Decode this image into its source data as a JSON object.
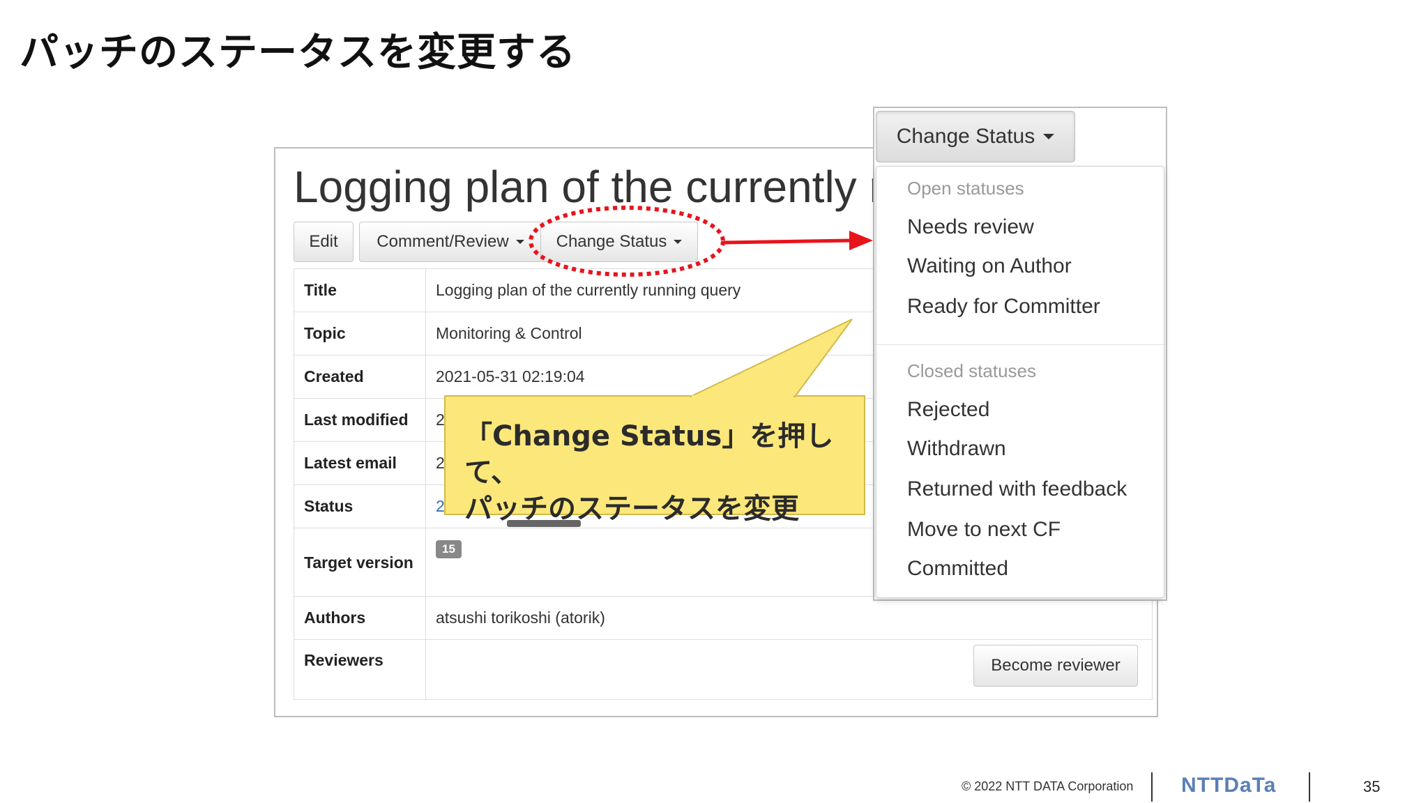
{
  "slide": {
    "title": "パッチのステータスを変更する",
    "callout_line1": "「Change Status」を押して、",
    "callout_line2": "パッチのステータスを変更"
  },
  "patch": {
    "heading": "Logging plan of the currently r",
    "buttons": {
      "edit": "Edit",
      "comment_review": "Comment/Review",
      "change_status": "Change Status"
    },
    "fields": {
      "title_label": "Title",
      "title_value": "Logging plan of the currently running query",
      "topic_label": "Topic",
      "topic_value": "Monitoring & Control",
      "created_label": "Created",
      "created_value": "2021-05-31 02:19:04",
      "last_modified_label": "Last modified",
      "last_modified_value": "2",
      "latest_email_label": "Latest email",
      "latest_email_value": "2",
      "status_label": "Status",
      "status_value": "2",
      "target_version_label": "Target version",
      "target_version_value": "15",
      "authors_label": "Authors",
      "authors_value": "atsushi torikoshi (atorik)",
      "reviewers_label": "Reviewers"
    },
    "become_reviewer": "Become reviewer"
  },
  "dropdown": {
    "button_label": "Change Status",
    "open_header": "Open statuses",
    "open_items": [
      "Needs review",
      "Waiting on Author",
      "Ready for Committer"
    ],
    "closed_header": "Closed statuses",
    "closed_items": [
      "Rejected",
      "Withdrawn",
      "Returned with feedback",
      "Move to next CF",
      "Committed"
    ]
  },
  "footer": {
    "copyright": "© 2022 NTT DATA Corporation",
    "logo": "NTTDaTa",
    "page_number": "35"
  },
  "colors": {
    "arrow": "#e8141c",
    "highlight_ring": "#e8141c",
    "callout_fill": "#fbe77a",
    "link": "#2a6ebb",
    "logo": "#5b7fb4"
  }
}
